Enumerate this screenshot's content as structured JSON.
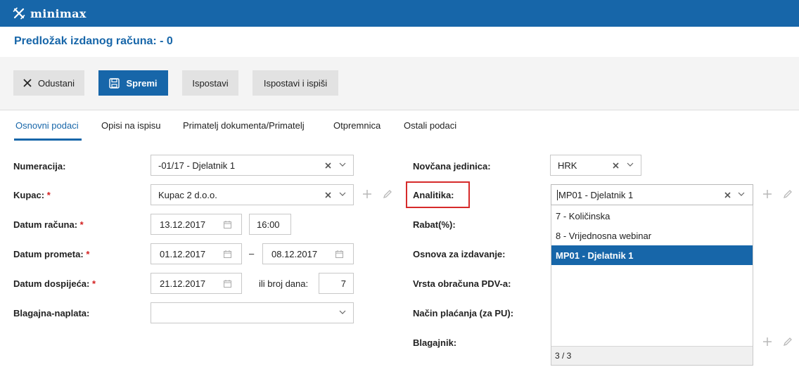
{
  "app": {
    "name": "minimax",
    "icon": "minimax-logo-icon"
  },
  "page": {
    "title": "Predložak izdanog računa: - 0"
  },
  "colors": {
    "brand": "#1766a9",
    "required": "#d32020",
    "highlight": "#d62b2b"
  },
  "toolbar": {
    "cancel_label": "Odustani",
    "save_label": "Spremi",
    "issue_label": "Ispostavi",
    "issue_print_label": "Ispostavi i ispiši"
  },
  "tabs": [
    {
      "label": "Osnovni podaci",
      "active": true
    },
    {
      "label": "Opisi na ispisu",
      "active": false
    },
    {
      "label": "Primatelj dokumenta/Primatelj",
      "active": false
    },
    {
      "label": "Otpremnica",
      "active": false
    },
    {
      "label": "Ostali podaci",
      "active": false
    }
  ],
  "form_left": {
    "numeracija": {
      "label": "Numeracija:",
      "value": "-01/17 - Djelatnik 1"
    },
    "kupac": {
      "label": "Kupac:",
      "required_mark": "*",
      "value": "Kupac 2 d.o.o."
    },
    "datum_racuna": {
      "label": "Datum računa:",
      "required_mark": "*",
      "date": "13.12.2017",
      "time": "16:00"
    },
    "datum_prometa": {
      "label": "Datum prometa:",
      "required_mark": "*",
      "from": "01.12.2017",
      "separator": "–",
      "to": "08.12.2017"
    },
    "datum_dospijeca": {
      "label": "Datum dospijeća:",
      "required_mark": "*",
      "date": "21.12.2017",
      "days_label": "ili broj dana:",
      "days": "7"
    },
    "blagajna": {
      "label": "Blagajna-naplata:",
      "value": ""
    }
  },
  "form_right": {
    "novcana_jedinica": {
      "label": "Novčana jedinica:",
      "value": "HRK"
    },
    "analitika": {
      "label": "Analitika:",
      "value": "MP01 - Djelatnik 1"
    },
    "rabat": {
      "label": "Rabat(%):"
    },
    "osnova": {
      "label": "Osnova za izdavanje:"
    },
    "vrsta_pdv": {
      "label": "Vrsta obračuna PDV-a:"
    },
    "nacin_placanja": {
      "label": "Način plaćanja (za PU):"
    },
    "blagajnik": {
      "label": "Blagajnik:"
    }
  },
  "analitika_dropdown": {
    "options": [
      {
        "label": "7 - Količinska",
        "selected": false
      },
      {
        "label": "8 - Vrijednosna webinar",
        "selected": false
      },
      {
        "label": "MP01 - Djelatnik 1",
        "selected": true
      }
    ],
    "footer": "3 / 3"
  }
}
